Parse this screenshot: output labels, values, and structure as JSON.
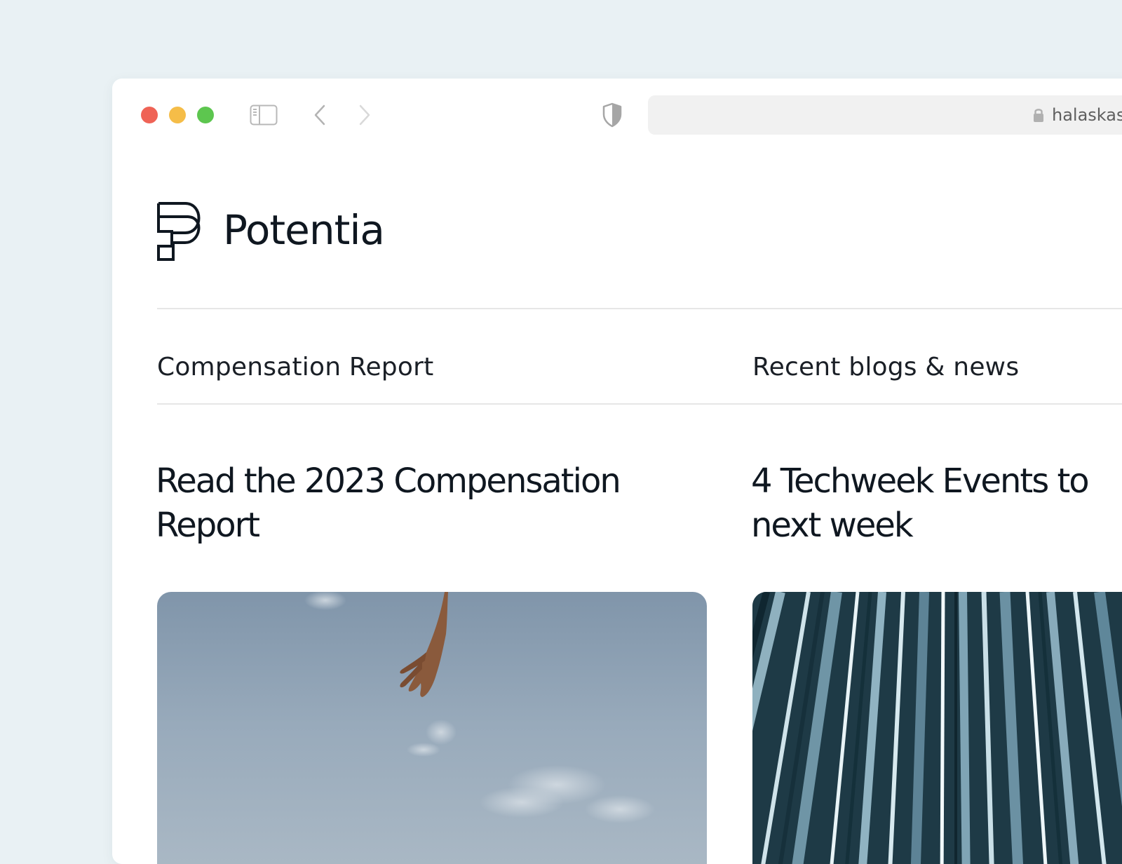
{
  "browser": {
    "url": "halaskastudio.com"
  },
  "site": {
    "name": "Potentia"
  },
  "sections": [
    {
      "label": "Compensation Report",
      "headline_line1": "Read the 2023 Compensation",
      "headline_line2": "Report",
      "image": "hand-reaching-into-sky-photo"
    },
    {
      "label": "Recent blogs & news",
      "headline_line1": "4 Techweek Events to",
      "headline_line2": "next week",
      "image": "light-streaks-photo"
    }
  ],
  "colors": {
    "page_background": "#e9f1f4",
    "window_background": "#ffffff",
    "traffic_close": "#ef6356",
    "traffic_minimize": "#f5bd48",
    "traffic_zoom": "#5dc64f",
    "text_primary": "#0f1720",
    "address_bar": "#f1f1f1"
  },
  "icons": [
    "sidebar-toggle-icon",
    "back-arrow-icon",
    "forward-arrow-icon",
    "privacy-shield-icon",
    "lock-icon",
    "potentia-logo-mark"
  ]
}
